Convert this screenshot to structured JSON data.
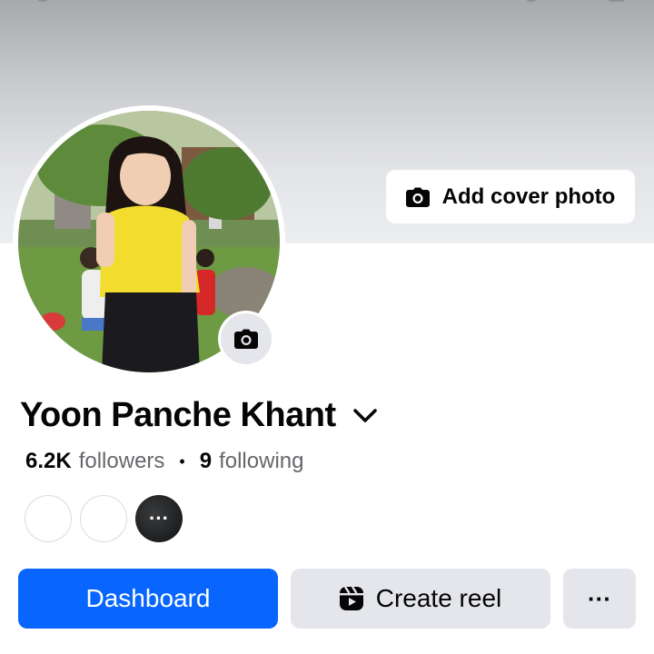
{
  "profile": {
    "name": "Yoon Panche Khant",
    "followers_count": "6.2K",
    "followers_label": "followers",
    "following_count": "9",
    "following_label": "following",
    "separator": "•"
  },
  "cover": {
    "add_cover_label": "Add cover photo"
  },
  "mutual_avatars": {
    "more_label": "···"
  },
  "actions": {
    "primary_label": "Dashboard",
    "secondary_label": "Create reel",
    "more_label": "···"
  },
  "icons": {
    "cover_camera": "camera-icon",
    "avatar_camera": "camera-icon",
    "name_dropdown": "chevron-down-icon",
    "reel": "reel-icon"
  },
  "colors": {
    "primary": "#0866ff",
    "secondary_bg": "#e4e6eb",
    "muted_text": "#65676b",
    "text": "#050505"
  }
}
